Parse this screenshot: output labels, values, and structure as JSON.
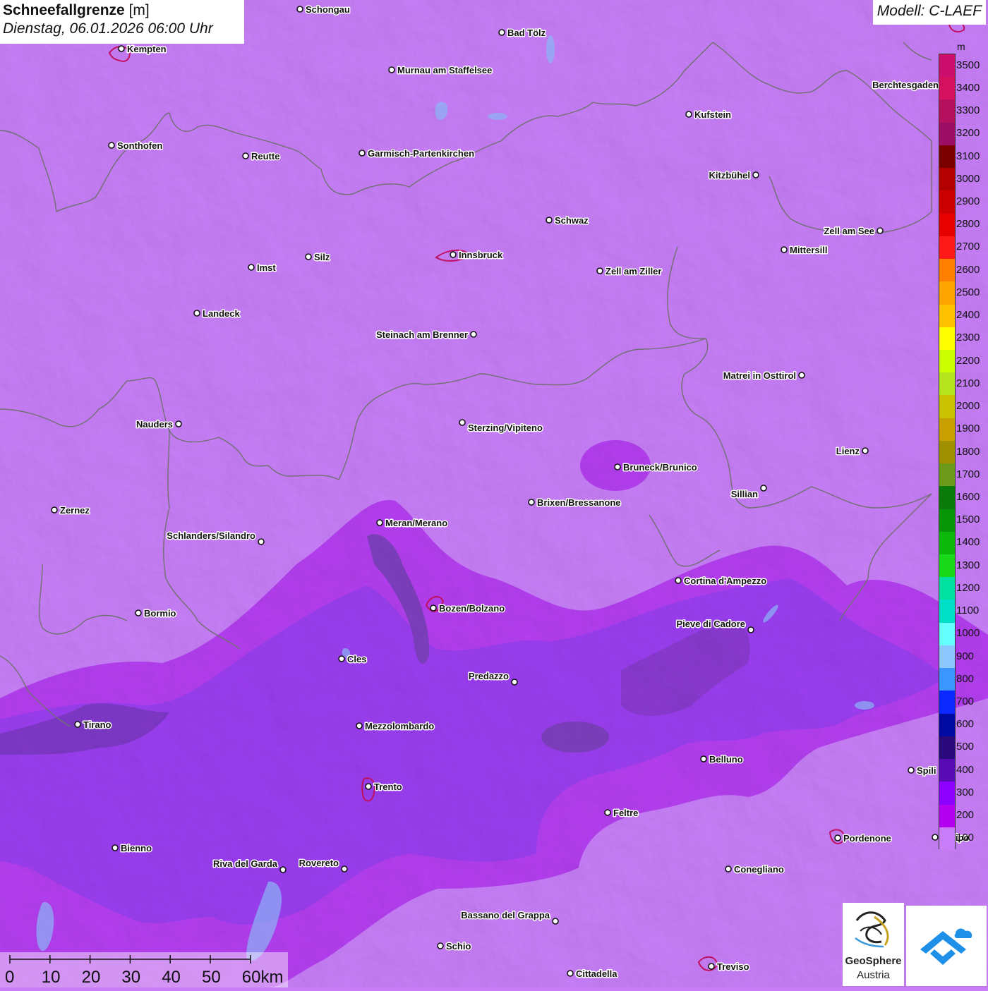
{
  "title": {
    "label_bold": "Schneefallgrenze",
    "unit": "[m]",
    "datetime": "Dienstag, 06.01.2026 06:00 Uhr"
  },
  "model": "Modell: C-LAEF",
  "legend": {
    "unit": "m",
    "levels": [
      "3500",
      "3400",
      "3300",
      "3200",
      "3100",
      "3000",
      "2900",
      "2800",
      "2700",
      "2600",
      "2500",
      "2400",
      "2300",
      "2200",
      "2100",
      "2000",
      "1900",
      "1800",
      "1700",
      "1600",
      "1500",
      "1400",
      "1300",
      "1200",
      "1100",
      "1000",
      "900",
      "800",
      "700",
      "600",
      "500",
      "400",
      "300",
      "200",
      "100"
    ],
    "colors": [
      "#cc0e6f",
      "#d4115f",
      "#b3105d",
      "#9c0e66",
      "#7a0000",
      "#b30000",
      "#cc0000",
      "#e60000",
      "#ff1a1a",
      "#ff7f00",
      "#ffa500",
      "#ffc100",
      "#ffff00",
      "#ccff00",
      "#b5e61d",
      "#c8c200",
      "#c8a000",
      "#a09000",
      "#6e9a1c",
      "#0a7a0a",
      "#089608",
      "#0cb80c",
      "#1ad81a",
      "#00e0a0",
      "#00e0c8",
      "#66ffff",
      "#8cc8ff",
      "#3c96ff",
      "#0a28ff",
      "#000aa0",
      "#2a0a7a",
      "#5a0ab4",
      "#8c00ff",
      "#b400f0",
      "#c87cf8"
    ]
  },
  "scale": {
    "ticks": [
      "0",
      "10",
      "20",
      "30",
      "40",
      "50",
      "60km"
    ]
  },
  "logos": {
    "geosphere_line1": "GeoSphere",
    "geosphere_line2": "Austria",
    "geosphere_icon": "geosphere-swirl-icon",
    "second_icon": "cloud-arrow-icon"
  },
  "cities": [
    {
      "name": "Schongau"
    },
    {
      "name": "Bad Tölz"
    },
    {
      "name": "Kempten"
    },
    {
      "name": "Murnau am Staffelsee"
    },
    {
      "name": "Berchtesgaden"
    },
    {
      "name": "Kufstein"
    },
    {
      "name": "Sonthofen"
    },
    {
      "name": "Reutte"
    },
    {
      "name": "Garmisch-Partenkirchen"
    },
    {
      "name": "Kitzbühel"
    },
    {
      "name": "Schwaz"
    },
    {
      "name": "Zell am See"
    },
    {
      "name": "Mittersill"
    },
    {
      "name": "Innsbruck"
    },
    {
      "name": "Silz"
    },
    {
      "name": "Imst"
    },
    {
      "name": "Zell am Ziller"
    },
    {
      "name": "Landeck"
    },
    {
      "name": "Steinach am Brenner"
    },
    {
      "name": "Matrei in Osttirol"
    },
    {
      "name": "Nauders"
    },
    {
      "name": "Sterzing/Vipiteno"
    },
    {
      "name": "Lienz"
    },
    {
      "name": "Bruneck/Brunico"
    },
    {
      "name": "Sillian"
    },
    {
      "name": "Brixen/Bressanone"
    },
    {
      "name": "Zernez"
    },
    {
      "name": "Meran/Merano"
    },
    {
      "name": "Schlanders/Silandro"
    },
    {
      "name": "Cortina d'Ampezzo"
    },
    {
      "name": "Bozen/Bolzano"
    },
    {
      "name": "Bormio"
    },
    {
      "name": "Pieve di Cadore"
    },
    {
      "name": "Cles"
    },
    {
      "name": "Predazzo"
    },
    {
      "name": "Tirano"
    },
    {
      "name": "Mezzolombardo"
    },
    {
      "name": "Belluno"
    },
    {
      "name": "Spili"
    },
    {
      "name": "Trento"
    },
    {
      "name": "Feltre"
    },
    {
      "name": "Pordenone"
    },
    {
      "name": "droipo"
    },
    {
      "name": "Bienno"
    },
    {
      "name": "Riva del Garda"
    },
    {
      "name": "Rovereto"
    },
    {
      "name": "Conegliano"
    },
    {
      "name": "Bassano del Grappa"
    },
    {
      "name": "Schio"
    },
    {
      "name": "Treviso"
    },
    {
      "name": "Cittadella"
    }
  ]
}
